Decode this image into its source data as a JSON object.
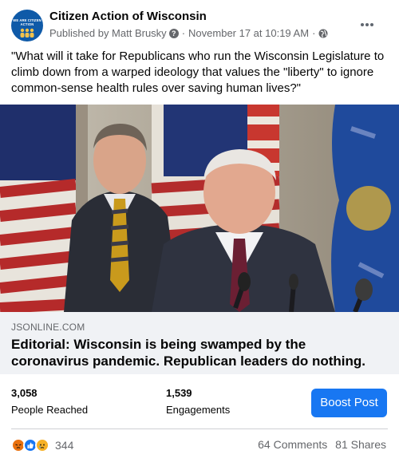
{
  "header": {
    "page_name": "Citizen Action of Wisconsin",
    "published_by": "Published by Matt Brusky",
    "timestamp": "November 17 at 10:19 AM",
    "avatar_text": "WE ARE CITIZEN ACTION",
    "privacy_icon": "globe-icon",
    "help_icon": "question-icon",
    "more_icon": "more-options-icon"
  },
  "post": {
    "text": "\"What will it take for Republicans who run the Wisconsin Legislature to climb down from a warped ideology that values the \"liberty\" to ignore common-sense health rules over saving human lives?\""
  },
  "link": {
    "domain": "JSONLINE.COM",
    "title": "Editorial: Wisconsin is being swamped by the coronavirus pandemic. Republican leaders do nothing."
  },
  "insights": {
    "reached_value": "3,058",
    "reached_label": "People Reached",
    "engagements_value": "1,539",
    "engagements_label": "Engagements",
    "boost_label": "Boost Post"
  },
  "reactions": {
    "icons": [
      "angry-icon",
      "like-icon",
      "sad-icon"
    ],
    "count": "344",
    "comments": "64 Comments",
    "shares": "81 Shares"
  },
  "colors": {
    "accent": "#1877f2",
    "secondary_text": "#65676b",
    "link_bg": "#f0f2f5"
  }
}
